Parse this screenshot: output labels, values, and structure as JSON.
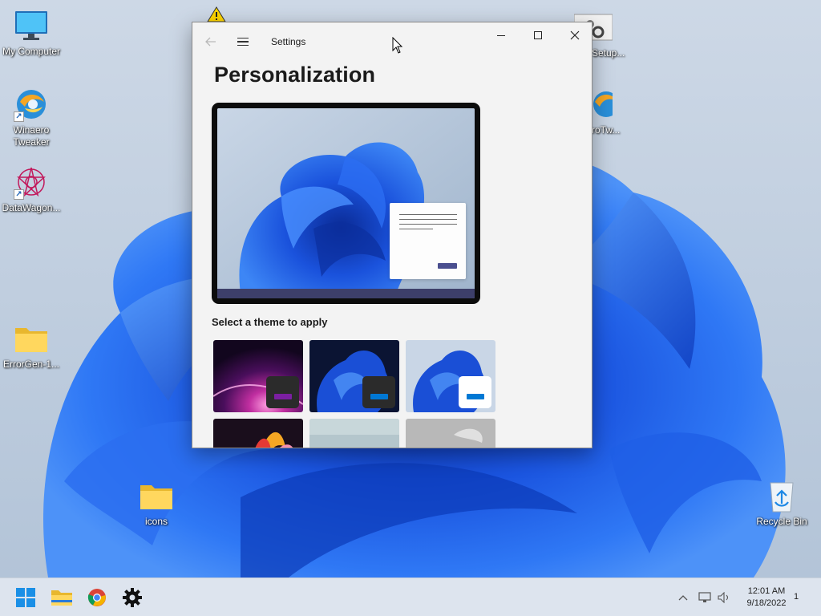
{
  "desktop": {
    "icons": [
      {
        "label": "My Computer"
      },
      {
        "label": "Winaero\nTweaker"
      },
      {
        "label": "DataWagon..."
      },
      {
        "label": "ErrorGen-1..."
      },
      {
        "label": "icons"
      },
      {
        "label": "Recycle Bin"
      },
      {
        "label": "Setup..."
      },
      {
        "label": "roTw..."
      }
    ]
  },
  "window": {
    "title": "Settings",
    "page_title": "Personalization",
    "section_label": "Select a theme to apply"
  },
  "taskbar": {
    "clock_time": "12:01 AM",
    "clock_date": "9/18/2022",
    "notification_count": "1"
  },
  "colors": {
    "accent_blue": "#0067c0",
    "accent_purple": "#6a1b9a",
    "wallpaper_blue": "#1a4fd6"
  }
}
